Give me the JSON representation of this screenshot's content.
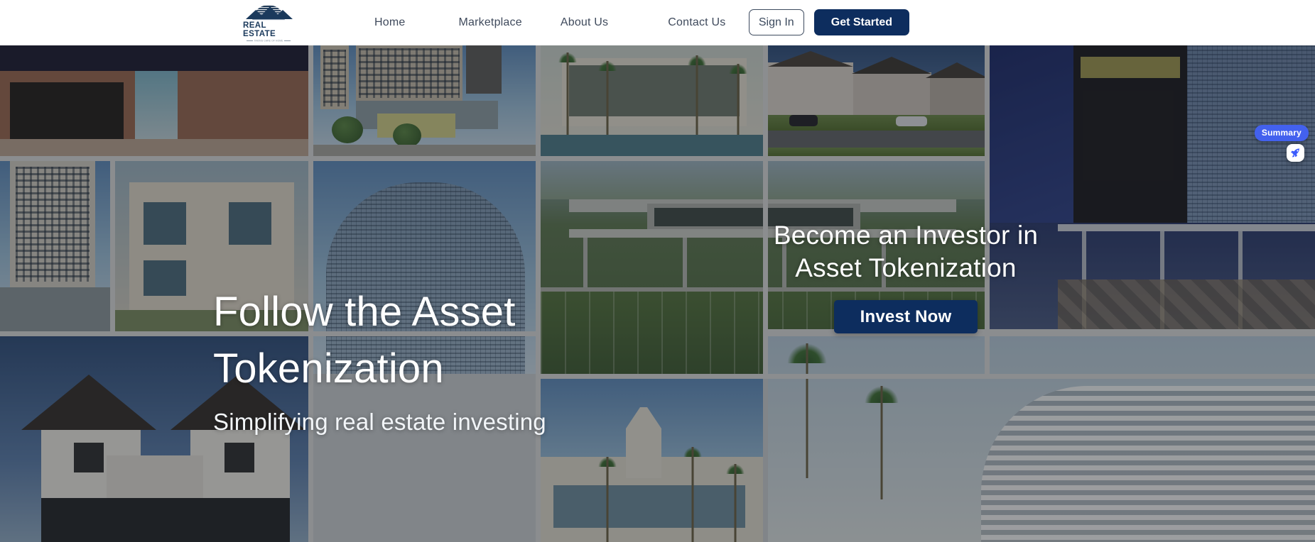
{
  "header": {
    "logo": {
      "name": "real-estate-logo",
      "wordmark": "REAL ESTATE",
      "tagline": "TAKING CARE OF HOME"
    },
    "nav": [
      {
        "label": "Home",
        "name": "nav-home"
      },
      {
        "label": "Marketplace",
        "name": "nav-marketplace"
      },
      {
        "label": "About Us",
        "name": "nav-about-us"
      },
      {
        "label": "Contact Us",
        "name": "nav-contact-us"
      }
    ],
    "sign_in_label": "Sign In",
    "get_started_label": "Get Started"
  },
  "hero": {
    "title_line1": "Follow the Asset",
    "title_line2": "Tokenization",
    "subtitle": "Simplifying real estate investing",
    "invest_title_line1": "Become an Investor in",
    "invest_title_line2": "Asset Tokenization",
    "invest_button_label": "Invest Now"
  },
  "summary_widget": {
    "badge_label": "Summary",
    "launcher_icon": "rocket-icon"
  },
  "colors": {
    "brand_navy": "#0d2d5e",
    "nav_text": "#3f4a5c",
    "badge_blue": "#4361ee",
    "overlay": "rgba(24,26,30,0.42)"
  }
}
